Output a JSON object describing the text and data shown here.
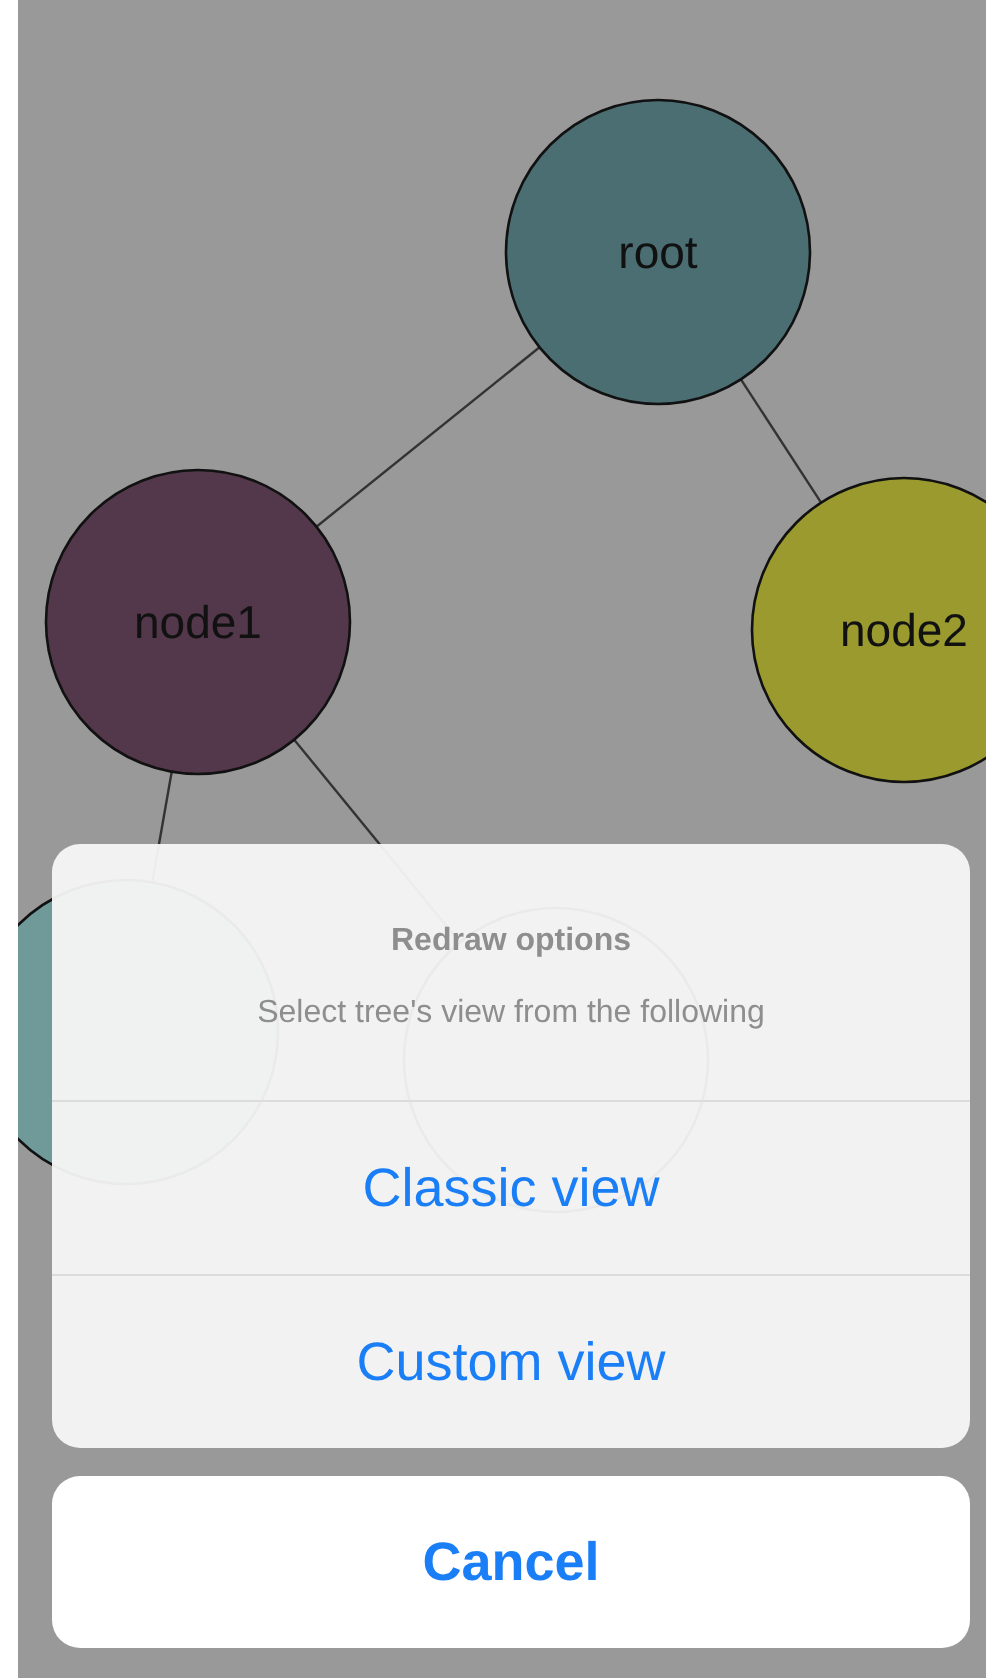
{
  "tree": {
    "nodes": [
      {
        "label": "root",
        "color": "#4a6e72",
        "children": [
          {
            "label": "node1",
            "color": "#53384b",
            "children": [
              {
                "color": "#6f9a99"
              },
              {
                "kind": "outline"
              }
            ]
          },
          {
            "label": "node2",
            "color": "#9a9a2e"
          }
        ]
      }
    ]
  },
  "action_sheet": {
    "title": "Redraw options",
    "message": "Select tree's view from the following",
    "actions": [
      "Classic view",
      "Custom view"
    ],
    "cancel": "Cancel"
  }
}
